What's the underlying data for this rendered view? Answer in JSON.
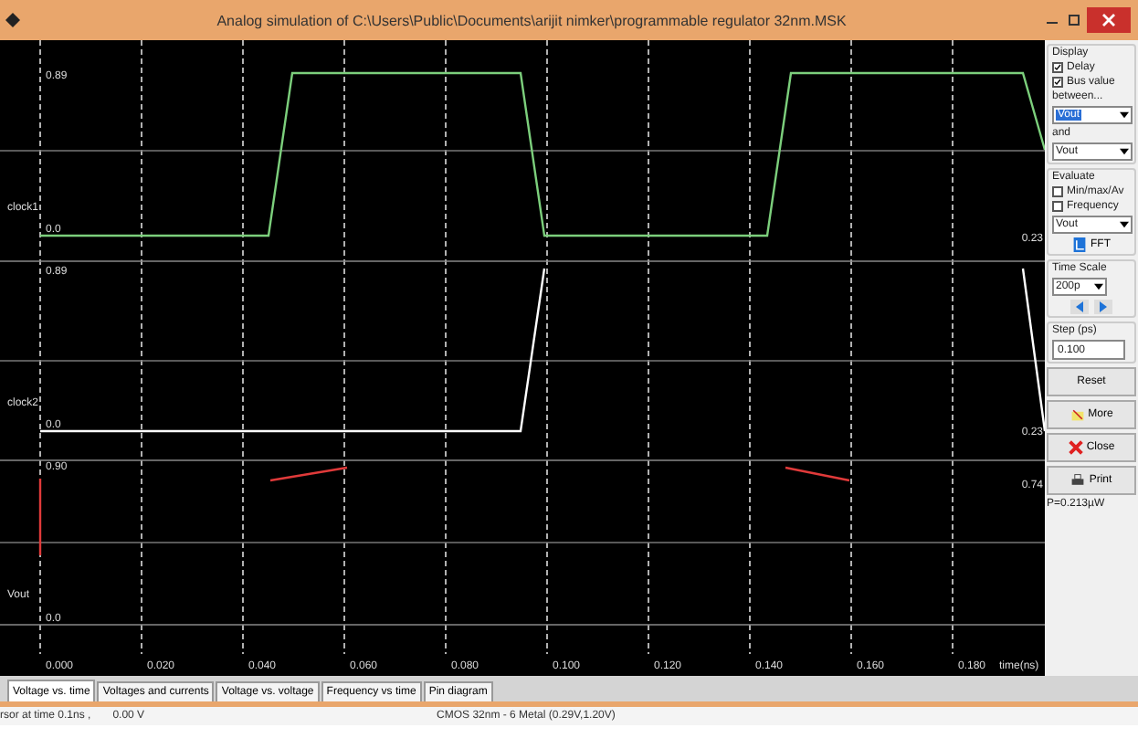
{
  "window": {
    "title": "Analog simulation of C:\\Users\\Public\\Documents\\arijit nimker\\programmable regulator 32nm.MSK"
  },
  "plot": {
    "lanes": [
      {
        "name": "clock1",
        "top_value": "0.89",
        "bottom_value": "0.0",
        "end_value": "0.23",
        "color": "#7ccf7c"
      },
      {
        "name": "clock2",
        "top_value": "0.89",
        "bottom_value": "0.0",
        "end_value": "0.23",
        "color": "#ffffff"
      },
      {
        "name": "Vout",
        "top_value": "0.90",
        "bottom_value": "0.0",
        "end_value": "0.74",
        "color": "#e03a3a"
      }
    ],
    "time_ticks": [
      "0.000",
      "0.020",
      "0.040",
      "0.060",
      "0.080",
      "0.100",
      "0.120",
      "0.140",
      "0.160",
      "0.180"
    ],
    "time_unit": "time(ns)"
  },
  "panel": {
    "display": {
      "title": "Display",
      "checks": [
        {
          "label": "Delay",
          "checked": true
        },
        {
          "label": "Bus value",
          "checked": true
        }
      ],
      "between_label": "between...",
      "from": "Vout",
      "and_label": "and",
      "to": "Vout"
    },
    "evaluate": {
      "title": "Evaluate",
      "checks": [
        {
          "label": "Min/max/Av",
          "checked": false
        },
        {
          "label": "Frequency",
          "checked": false
        }
      ],
      "signal": "Vout",
      "fft": "FFT"
    },
    "time_scale": {
      "title": "Time Scale",
      "value": "200p"
    },
    "step": {
      "title": "Step (ps)",
      "value": "0.100"
    },
    "buttons": [
      {
        "label": "Reset",
        "kind": "plain"
      },
      {
        "label": "More",
        "kind": "more"
      },
      {
        "label": "Close",
        "kind": "close"
      },
      {
        "label": "Print",
        "kind": "print"
      }
    ],
    "power": "P=0.213µW"
  },
  "tabs": [
    {
      "label": "Voltage vs. time",
      "selected": true
    },
    {
      "label": "Voltages and currents",
      "selected": false
    },
    {
      "label": "Voltage vs. voltage",
      "selected": false
    },
    {
      "label": "Frequency vs time",
      "selected": false
    },
    {
      "label": "Pin diagram",
      "selected": false
    }
  ],
  "status_bar": {
    "cursor": "rsor at time 0.1ns ,",
    "voltage": "0.00 V",
    "technology": "CMOS 32nm - 6 Metal (0.29V,1.20V)"
  }
}
